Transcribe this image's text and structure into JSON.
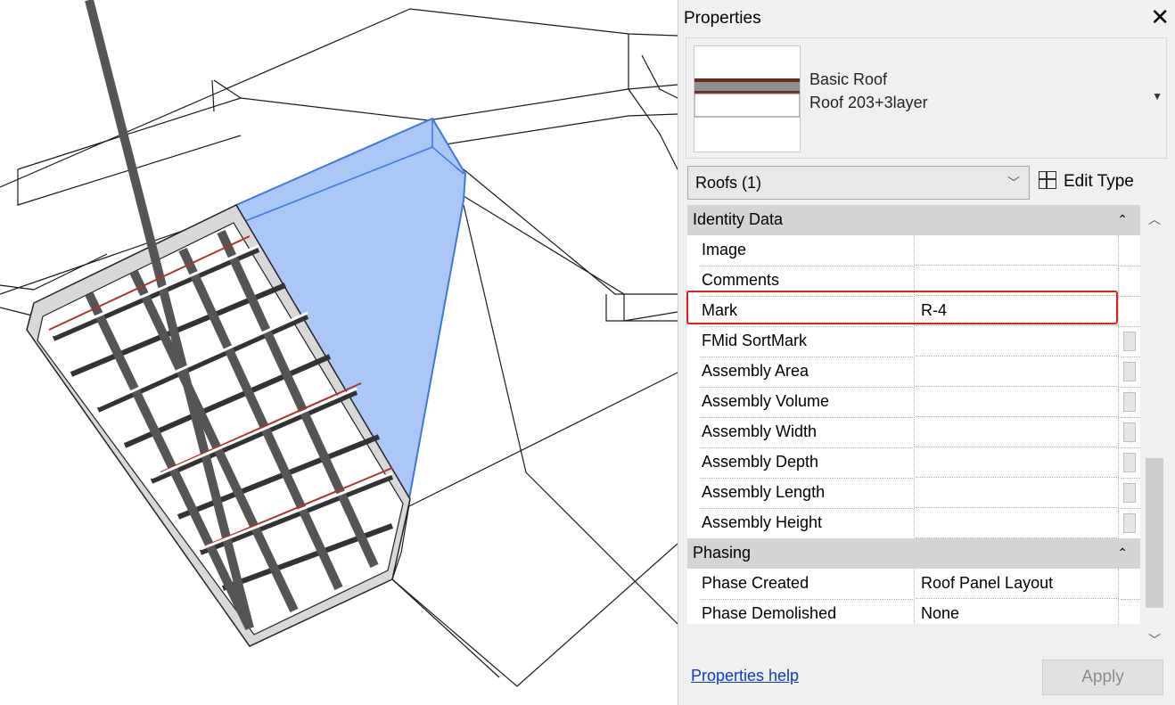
{
  "properties": {
    "title": "Properties",
    "close_symbol": "✕",
    "type_selector": {
      "family": "Basic Roof",
      "type": "Roof 203+3layer",
      "dropdown_icon": "triangle-down-icon"
    },
    "filter": {
      "selected": "Roofs (1)"
    },
    "edit_type_label": "Edit Type",
    "groups": [
      {
        "name": "Identity Data",
        "rows": [
          {
            "label": "Image",
            "value": ""
          },
          {
            "label": "Comments",
            "value": ""
          },
          {
            "label": "Mark",
            "value": "R-4"
          },
          {
            "label": "FMid SortMark",
            "value": ""
          },
          {
            "label": "Assembly Area",
            "value": ""
          },
          {
            "label": "Assembly Volume",
            "value": ""
          },
          {
            "label": "Assembly Width",
            "value": ""
          },
          {
            "label": "Assembly Depth",
            "value": ""
          },
          {
            "label": "Assembly Length",
            "value": ""
          },
          {
            "label": "Assembly Height",
            "value": ""
          }
        ]
      },
      {
        "name": "Phasing",
        "rows": [
          {
            "label": "Phase Created",
            "value": "Roof Panel Layout"
          },
          {
            "label": "Phase Demolished",
            "value": "None"
          }
        ]
      }
    ],
    "help_link": "Properties help",
    "apply_label": "Apply"
  },
  "colors": {
    "selection_fill": "#aac7f7",
    "selection_edge": "#3a78e0",
    "highlight": "#e0201a",
    "layer_red": "#b2332a"
  }
}
